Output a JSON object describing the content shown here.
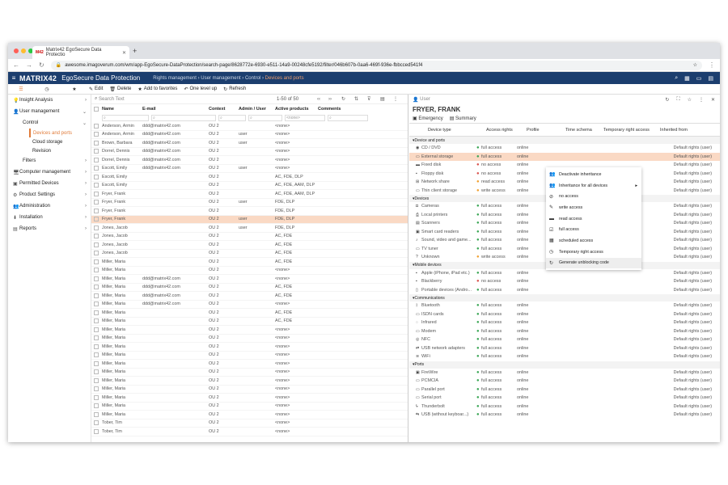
{
  "browser": {
    "tab_title": "Matrix42 EgoSecure Data Protectio",
    "url": "awesome.imagoverum.com/wm/app-EgoSecure-DataProtection/search-page/8628772e-6930-e511-14a9-00248cfe5192/filter/046b607b-0aa6-469f-936e-fbbcced541f4",
    "new_tab": "+"
  },
  "app": {
    "logo": "MATRIX42",
    "title": "EgoSecure Data Protection",
    "breadcrumbs": [
      "Rights management",
      "User management",
      "Control",
      "Devices and ports"
    ]
  },
  "toolbar": {
    "edit": "Edit",
    "delete": "Delete",
    "favorites": "Add to favorites",
    "level_up": "One level up",
    "refresh": "Refresh"
  },
  "sidebar": {
    "items": [
      {
        "label": "Insight Analysis",
        "level": 0,
        "icon": "bulb-icon"
      },
      {
        "label": "User management",
        "level": 0,
        "icon": "user-icon"
      },
      {
        "label": "Control",
        "level": 1
      },
      {
        "label": "Devices and ports",
        "level": 2,
        "active": true
      },
      {
        "label": "Cloud storage",
        "level": 2
      },
      {
        "label": "Revision",
        "level": 2
      },
      {
        "label": "Filters",
        "level": 1
      },
      {
        "label": "Computer management",
        "level": 0,
        "icon": "computer-icon"
      },
      {
        "label": "Permitted Devices",
        "level": 0,
        "icon": "device-icon"
      },
      {
        "label": "Product Settings",
        "level": 0,
        "icon": "settings-icon"
      },
      {
        "label": "Administration",
        "level": 0,
        "icon": "admin-icon"
      },
      {
        "label": "Installation",
        "level": 0,
        "icon": "install-icon"
      },
      {
        "label": "Reports",
        "level": 0,
        "icon": "report-icon"
      }
    ]
  },
  "grid": {
    "search_placeholder": "Search Text",
    "pagination": "1-50 of 50",
    "columns": [
      "Name",
      "E-mail",
      "Context",
      "Admin / User",
      "Active products",
      "Comments"
    ],
    "filter_placeholder": "<none>",
    "rows": [
      [
        "Anderson, Armin",
        "ddd@matrix42.com",
        "OU 2",
        "",
        "<none>"
      ],
      [
        "Anderson, Armin",
        "ddd@matrix42.com",
        "OU 2",
        "user",
        "<none>"
      ],
      [
        "Brown, Barbara",
        "ddd@matrix42.com",
        "OU 2",
        "user",
        "<none>"
      ],
      [
        "Dorrel, Dennis",
        "ddd@matrix42.com",
        "OU 2",
        "",
        "<none>"
      ],
      [
        "Dorrel, Dennis",
        "ddd@matrix42.com",
        "OU 2",
        "",
        "<none>"
      ],
      [
        "Escott, Emily",
        "ddd@matrix42.com",
        "OU 2",
        "user",
        "<none>"
      ],
      [
        "Escott, Emily",
        "",
        "OU 2",
        "",
        "AC, FDE, DLP"
      ],
      [
        "Escott, Emily",
        "",
        "OU 2",
        "",
        "AC, FDE, AAM, DLP"
      ],
      [
        "Fryer, Frank",
        "",
        "OU 2",
        "",
        "AC, FDE, AAM, DLP"
      ],
      [
        "Fryer, Frank",
        "",
        "OU 2",
        "user",
        "FDE, DLP"
      ],
      [
        "Fryer, Frank",
        "",
        "OU 2",
        "",
        "FDE, DLP"
      ],
      [
        "Fryer, Frank",
        "",
        "OU 2",
        "user",
        "FDE, DLP"
      ],
      [
        "Jones, Jacob",
        "",
        "OU 2",
        "user",
        "FDE, DLP"
      ],
      [
        "Jones, Jacob",
        "",
        "OU 2",
        "",
        "AC, FDE"
      ],
      [
        "Jones, Jacob",
        "",
        "OU 2",
        "",
        "AC, FDE"
      ],
      [
        "Jones, Jacob",
        "",
        "OU 2",
        "",
        "AC, FDE"
      ],
      [
        "Miller, Maria",
        "",
        "OU 2",
        "",
        "AC, FDE"
      ],
      [
        "Miller, Maria",
        "",
        "OU 2",
        "",
        "<none>"
      ],
      [
        "Miller, Maria",
        "ddd@matrix42.com",
        "OU 2",
        "",
        "<none>"
      ],
      [
        "Miller, Maria",
        "ddd@matrix42.com",
        "OU 2",
        "",
        "AC, FDE"
      ],
      [
        "Miller, Maria",
        "ddd@matrix42.com",
        "OU 2",
        "",
        "AC, FDE"
      ],
      [
        "Miller, Maria",
        "ddd@matrix42.com",
        "OU 2",
        "",
        "<none>"
      ],
      [
        "Miller, Maria",
        "",
        "OU 2",
        "",
        "AC, FDE"
      ],
      [
        "Miller, Maria",
        "",
        "OU 2",
        "",
        "AC, FDE"
      ],
      [
        "Miller, Maria",
        "",
        "OU 2",
        "",
        "<none>"
      ],
      [
        "Miller, Maria",
        "",
        "OU 2",
        "",
        "<none>"
      ],
      [
        "Miller, Maria",
        "",
        "OU 2",
        "",
        "<none>"
      ],
      [
        "Miller, Maria",
        "",
        "OU 2",
        "",
        "<none>"
      ],
      [
        "Miller, Maria",
        "",
        "OU 2",
        "",
        "<none>"
      ],
      [
        "Miller, Maria",
        "",
        "OU 2",
        "",
        "<none>"
      ],
      [
        "Miller, Maria",
        "",
        "OU 2",
        "",
        "<none>"
      ],
      [
        "Miller, Maria",
        "",
        "OU 2",
        "",
        "<none>"
      ],
      [
        "Miller, Maria",
        "",
        "OU 2",
        "",
        "<none>"
      ],
      [
        "Miller, Maria",
        "",
        "OU 2",
        "",
        "<none>"
      ],
      [
        "Miller, Maria",
        "",
        "OU 2",
        "",
        "<none>"
      ],
      [
        "Tober, Tim",
        "",
        "OU 2",
        "",
        "<none>"
      ],
      [
        "Tober, Tim",
        "",
        "OU 2",
        "",
        "<none>"
      ]
    ],
    "highlight_row": 11
  },
  "detail": {
    "label": "User",
    "name": "FRYER, FRANK",
    "tabs": [
      "Emergency",
      "Summary"
    ],
    "columns": [
      "Device type",
      "Access rights",
      "Profile",
      "Time schema",
      "Temporary right access",
      "Inherited from"
    ],
    "sections": [
      {
        "title": "Device and ports",
        "rows": [
          [
            "CD / DVD",
            "full access",
            "online",
            "Default rights (user)",
            "green"
          ],
          [
            "External storage",
            "full access",
            "online",
            "Default rights (user)",
            "green"
          ],
          [
            "Fixed disk",
            "no access",
            "online",
            "Default rights (user)",
            "red"
          ],
          [
            "Floppy disk",
            "no access",
            "online",
            "Default rights (user)",
            "red"
          ],
          [
            "Network share",
            "read access",
            "online",
            "Default rights (user)",
            "orange"
          ],
          [
            "Thin client storage",
            "write access",
            "online",
            "Default rights (user)",
            "orange"
          ]
        ]
      },
      {
        "title": "Devices",
        "rows": [
          [
            "Cameras",
            "full access",
            "online",
            "Default rights (user)",
            "green"
          ],
          [
            "Local printers",
            "full access",
            "online",
            "Default rights (user)",
            "green"
          ],
          [
            "Scanners",
            "full access",
            "online",
            "Default rights (user)",
            "green"
          ],
          [
            "Smart card readers",
            "full access",
            "online",
            "Default rights (user)",
            "green"
          ],
          [
            "Sound, video and game...",
            "full access",
            "online",
            "Default rights (user)",
            "green"
          ],
          [
            "TV tuner",
            "full access",
            "online",
            "Default rights (user)",
            "green"
          ],
          [
            "Unknown",
            "write access",
            "online",
            "Default rights (user)",
            "orange"
          ]
        ]
      },
      {
        "title": "Mobile devices",
        "rows": [
          [
            "Apple (iPhone, iPad etc.)",
            "full access",
            "online",
            "Default rights (user)",
            "green"
          ],
          [
            "Blackberry",
            "no access",
            "online",
            "Default rights (user)",
            "red"
          ],
          [
            "Portable devices (Andro...",
            "full access",
            "online",
            "Default rights (user)",
            "green"
          ]
        ]
      },
      {
        "title": "Communications",
        "rows": [
          [
            "Bluetooth",
            "full access",
            "online",
            "Default rights (user)",
            "green"
          ],
          [
            "ISDN cards",
            "full access",
            "online",
            "Default rights (user)",
            "green"
          ],
          [
            "Infrared",
            "full access",
            "online",
            "Default rights (user)",
            "green"
          ],
          [
            "Modem",
            "full access",
            "online",
            "Default rights (user)",
            "green"
          ],
          [
            "NFC",
            "full access",
            "online",
            "Default rights (user)",
            "green"
          ],
          [
            "USB network adapters",
            "full access",
            "online",
            "Default rights (user)",
            "green"
          ],
          [
            "WiFi",
            "full access",
            "online",
            "Default rights (user)",
            "green"
          ]
        ]
      },
      {
        "title": "Ports",
        "rows": [
          [
            "FireWire",
            "full access",
            "online",
            "Default rights (user)",
            "green"
          ],
          [
            "PCMCIA",
            "full access",
            "online",
            "Default rights (user)",
            "green"
          ],
          [
            "Parallel port",
            "full access",
            "online",
            "Default rights (user)",
            "green"
          ],
          [
            "Serial port",
            "full access",
            "online",
            "Default rights (user)",
            "green"
          ],
          [
            "Thunderbolt",
            "full access",
            "online",
            "Default rights (user)",
            "green"
          ],
          [
            "USB (without keyboar...)",
            "full access",
            "online",
            "Default rights (user)",
            "green"
          ]
        ]
      }
    ],
    "highlight": "External storage"
  },
  "context_menu": {
    "items": [
      {
        "label": "Deactivate inheritance",
        "icon": "users-icon"
      },
      {
        "label": "Inheritance for all devices",
        "icon": "users-icon",
        "submenu": true
      },
      {
        "label": "no access",
        "icon": "block-icon"
      },
      {
        "label": "write access",
        "icon": "pencil-icon"
      },
      {
        "label": "read access",
        "icon": "book-icon"
      },
      {
        "label": "full access",
        "icon": "check-icon"
      },
      {
        "label": "scheduled access",
        "icon": "calendar-icon"
      },
      {
        "label": "Temporary right access",
        "icon": "clock-icon"
      },
      {
        "label": "Generate unblocking code",
        "icon": "refresh-icon",
        "hover": true
      }
    ]
  },
  "colors": {
    "header": "#1c3e6e",
    "accent": "#e07b3a",
    "highlight": "#fad9c4",
    "green": "#3aa655",
    "red": "#d9534f",
    "orange": "#f0a030"
  }
}
